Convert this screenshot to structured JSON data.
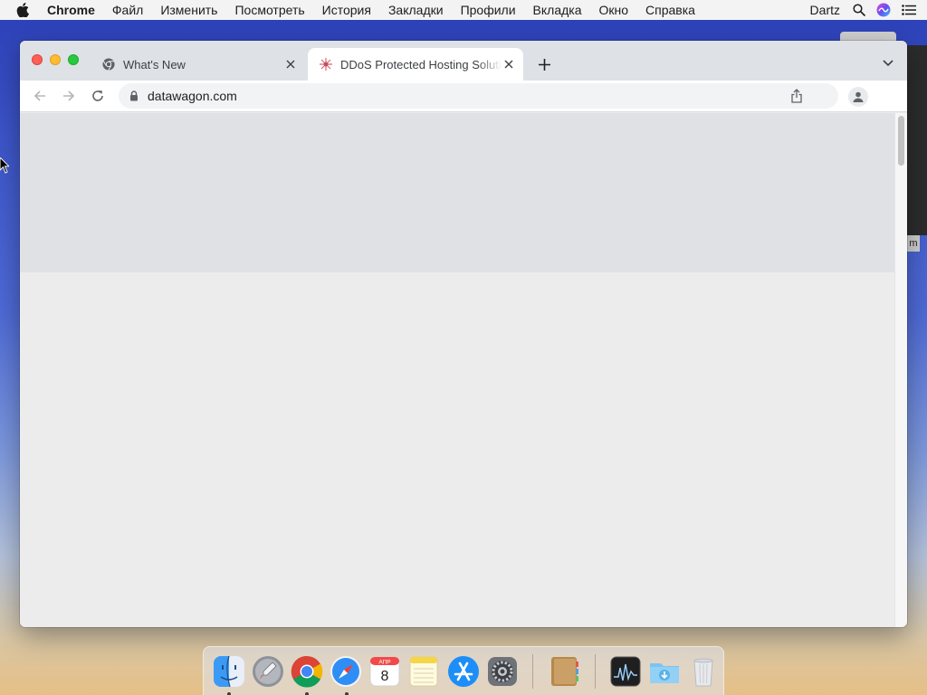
{
  "menubar": {
    "app_name": "Chrome",
    "items": [
      "Файл",
      "Изменить",
      "Посмотреть",
      "История",
      "Закладки",
      "Профили",
      "Вкладка",
      "Окно",
      "Справка"
    ],
    "user": "Dartz"
  },
  "background_window": {
    "tag": "m"
  },
  "browser": {
    "tabs": [
      {
        "title": "What's New",
        "favicon": "chrome-icon",
        "active": false
      },
      {
        "title": "DDoS Protected Hosting Solutions",
        "favicon": "datawagon-icon",
        "active": true
      }
    ],
    "omnibox": {
      "url": "datawagon.com",
      "secure": true
    },
    "page": {
      "loading": true
    }
  },
  "dock": {
    "items": [
      {
        "name": "finder-icon",
        "running": true
      },
      {
        "name": "launchpad-icon",
        "running": false
      },
      {
        "name": "chrome-icon",
        "running": true
      },
      {
        "name": "safari-icon",
        "running": true
      },
      {
        "name": "calendar-icon",
        "running": false,
        "month": "АПР",
        "day": "8"
      },
      {
        "name": "notes-icon",
        "running": false
      },
      {
        "name": "app-store-icon",
        "running": false
      },
      {
        "name": "system-preferences-icon",
        "running": false
      },
      {
        "name": "contacts-icon",
        "running": false
      },
      {
        "name": "activity-monitor-icon",
        "running": false
      },
      {
        "name": "downloads-folder-icon",
        "running": false
      },
      {
        "name": "trash-icon",
        "running": false
      }
    ]
  },
  "colors": {
    "traffic_close": "#fe5f57",
    "traffic_min": "#febc2e",
    "traffic_max": "#28c840",
    "tabstrip": "#dee1e6",
    "accent_blue": "#4e6ad6"
  }
}
